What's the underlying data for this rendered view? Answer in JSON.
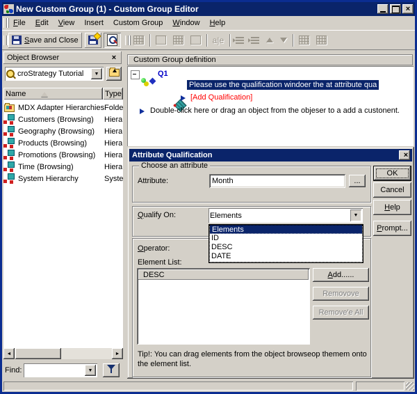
{
  "window": {
    "title": "New Custom Group (1) - Custom Group Editor"
  },
  "menu": {
    "items": [
      "File",
      "Edit",
      "View",
      "Insert",
      "Custom Group",
      "Window",
      "Help"
    ]
  },
  "toolbar": {
    "save_and_close_label": "Save and Close",
    "ae_label": "a|e"
  },
  "icons": {
    "dropdown": "▼",
    "left": "◄",
    "right": "►",
    "close": "×"
  },
  "object_browser": {
    "title": "Object Browser",
    "project_value": "croStrategy Tutorial",
    "columns": {
      "name": "Name",
      "type": "Type"
    },
    "rows": [
      {
        "name": "MDX Adapter Hierarchies",
        "type": "Folde"
      },
      {
        "name": "Customers (Browsing)",
        "type": "Hiera"
      },
      {
        "name": "Geography (Browsing)",
        "type": "Hiera"
      },
      {
        "name": "Products (Browsing)",
        "type": "Hiera"
      },
      {
        "name": "Promotions (Browsing)",
        "type": "Hiera"
      },
      {
        "name": "Time (Browsing)",
        "type": "Hiera"
      },
      {
        "name": "System Hierarchy",
        "type": "Syste"
      }
    ],
    "find_label": "Find:"
  },
  "definition": {
    "header": "Custom Group definition",
    "q1_label": "Q1",
    "selected_item": "Please use the qualification windoer the at attribute qua",
    "add_qualification": "[Add Qualification]",
    "hint": "Double-click here or drag an object from the objeser to a add a custonent."
  },
  "dialog": {
    "title": "Attribute Qualification",
    "choose_group_label": "Choose an attribute",
    "attribute_label": "Attribute:",
    "attribute_value": "Month",
    "browse_button": "...",
    "qualify_on_label": "Qualify On:",
    "qualify_on_value": "Elements",
    "options": [
      "Elements",
      "ID",
      "DESC",
      "DATE"
    ],
    "operator_label": "Operator:",
    "element_list_label": "Element List:",
    "element_list_header": "DESC",
    "ok": "OK",
    "cancel": "Cancel",
    "help": "Help",
    "prompt": "Prompt...",
    "add": "Add......",
    "remove": "Removove",
    "remove_all": "Remove'e All",
    "tip": "Tip!:  You can drag elements from the object browseop themem onto the element list."
  },
  "colors": {
    "titlebar": "#0a246a",
    "selection": "#0a246a",
    "window_border": "#0b2d91",
    "link_blue": "#0000c8",
    "accent_red": "#ff0000",
    "face": "#d4d0c8"
  }
}
